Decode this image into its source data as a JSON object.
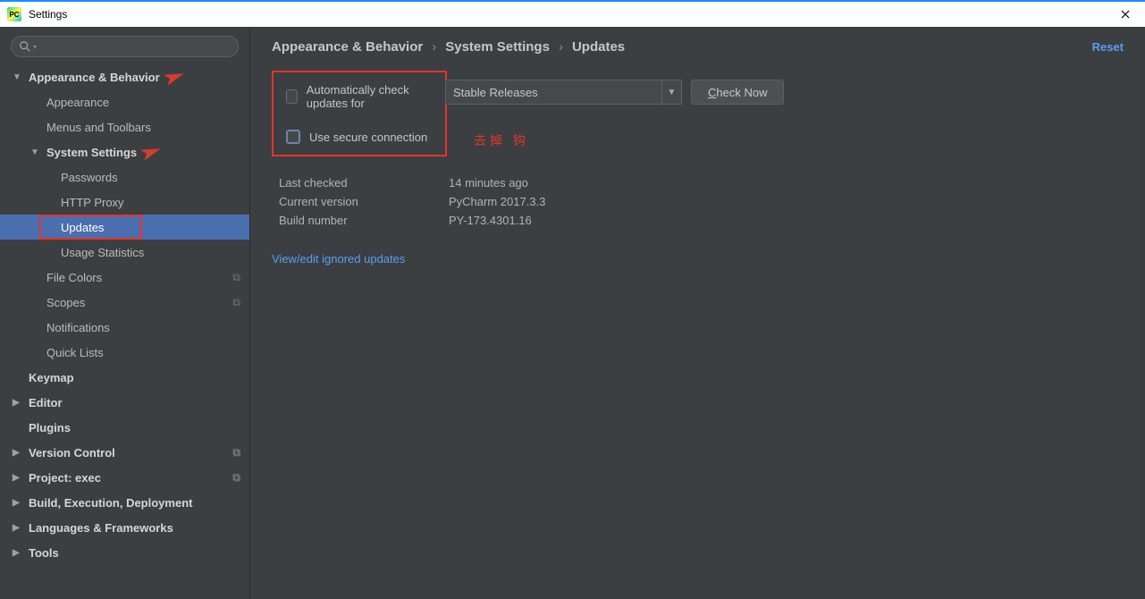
{
  "window": {
    "title": "Settings"
  },
  "sidebar": {
    "search_placeholder": "",
    "items": [
      {
        "label": "Appearance & Behavior",
        "level": 0,
        "bold": true,
        "arrow": "down",
        "annot_arrow": true
      },
      {
        "label": "Appearance",
        "level": 1
      },
      {
        "label": "Menus and Toolbars",
        "level": 1
      },
      {
        "label": "System Settings",
        "level": 1,
        "bold": true,
        "arrow": "down",
        "annot_arrow": true
      },
      {
        "label": "Passwords",
        "level": 2
      },
      {
        "label": "HTTP Proxy",
        "level": 2
      },
      {
        "label": "Updates",
        "level": 2,
        "selected": true,
        "annot_box": true
      },
      {
        "label": "Usage Statistics",
        "level": 2
      },
      {
        "label": "File Colors",
        "level": 1,
        "proj": true
      },
      {
        "label": "Scopes",
        "level": 1,
        "proj": true
      },
      {
        "label": "Notifications",
        "level": 1
      },
      {
        "label": "Quick Lists",
        "level": 1
      },
      {
        "label": "Keymap",
        "level": 0,
        "bold": true
      },
      {
        "label": "Editor",
        "level": 0,
        "bold": true,
        "arrow": "right"
      },
      {
        "label": "Plugins",
        "level": 0,
        "bold": true
      },
      {
        "label": "Version Control",
        "level": 0,
        "bold": true,
        "arrow": "right",
        "proj": true
      },
      {
        "label": "Project: exec",
        "level": 0,
        "bold": true,
        "arrow": "right",
        "proj": true
      },
      {
        "label": "Build, Execution, Deployment",
        "level": 0,
        "bold": true,
        "arrow": "right"
      },
      {
        "label": "Languages & Frameworks",
        "level": 0,
        "bold": true,
        "arrow": "right"
      },
      {
        "label": "Tools",
        "level": 0,
        "bold": true,
        "arrow": "right"
      }
    ]
  },
  "breadcrumb": [
    "Appearance & Behavior",
    "System Settings",
    "Updates"
  ],
  "reset_label": "Reset",
  "form": {
    "auto_check_label": "Automatically check updates for",
    "secure_conn_label": "Use secure connection",
    "channel_value": "Stable Releases",
    "check_now_label": "Check Now",
    "annotation": "去掉 钩"
  },
  "info": {
    "last_checked_label": "Last checked",
    "last_checked_value": "14 minutes ago",
    "current_version_label": "Current version",
    "current_version_value": "PyCharm 2017.3.3",
    "build_number_label": "Build number",
    "build_number_value": "PY-173.4301.16"
  },
  "link_label": "View/edit ignored updates"
}
